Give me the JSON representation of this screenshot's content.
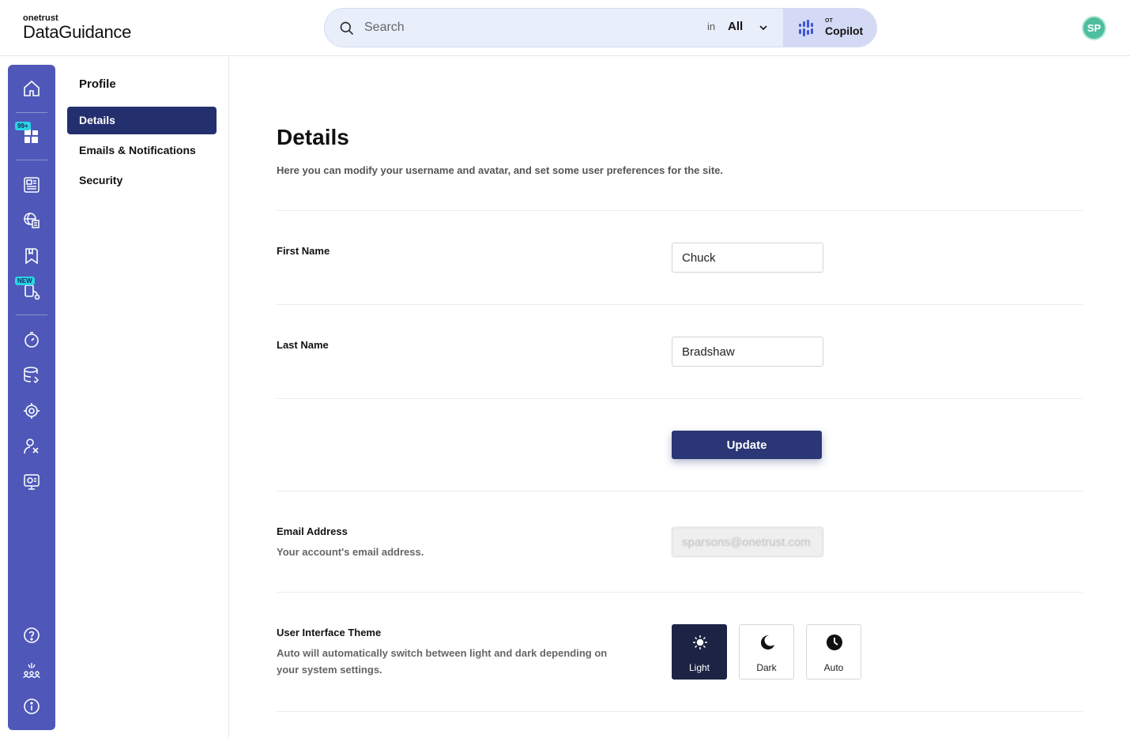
{
  "header": {
    "logo_small": "onetrust",
    "logo_big": "DataGuidance",
    "search_placeholder": "Search",
    "search_scope_prefix": "in",
    "search_scope_value": "All",
    "copilot_prefix": "OT",
    "copilot_label": "Copilot",
    "avatar_initials": "SP"
  },
  "rail": {
    "badge_notifications": "99+",
    "badge_new": "NEW"
  },
  "subnav": {
    "title": "Profile",
    "items": [
      {
        "label": "Details"
      },
      {
        "label": "Emails & Notifications"
      },
      {
        "label": "Security"
      }
    ]
  },
  "main": {
    "title": "Details",
    "description": "Here you can modify your username and avatar, and set some user preferences for the site.",
    "first_name_label": "First Name",
    "first_name_value": "Chuck",
    "last_name_label": "Last Name",
    "last_name_value": "Bradshaw",
    "update_label": "Update",
    "email_label": "Email Address",
    "email_help": "Your account's email address.",
    "email_value": "sparsons@onetrust.com",
    "theme_label": "User Interface Theme",
    "theme_help": "Auto will automatically switch between light and dark depending on your system settings.",
    "themes": [
      {
        "label": "Light",
        "icon": "sun-icon"
      },
      {
        "label": "Dark",
        "icon": "moon-icon"
      },
      {
        "label": "Auto",
        "icon": "clock-icon"
      }
    ],
    "selected_theme": "Light"
  },
  "colors": {
    "rail": "#4f58b8",
    "accent": "#24306e",
    "avatar": "#4dbf9e"
  }
}
